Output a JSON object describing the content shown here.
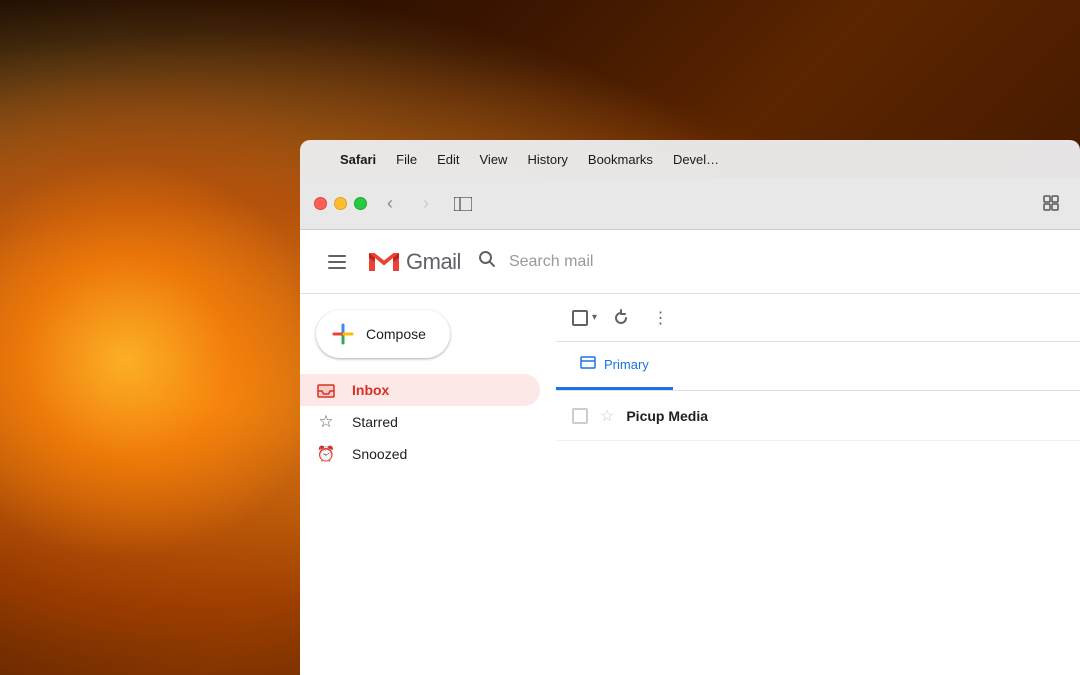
{
  "background": {
    "description": "Warm bokeh background with lamp/candle light"
  },
  "menubar": {
    "apple_symbol": "",
    "items": [
      {
        "label": "Safari",
        "bold": true
      },
      {
        "label": "File",
        "bold": false
      },
      {
        "label": "Edit",
        "bold": false
      },
      {
        "label": "View",
        "bold": false
      },
      {
        "label": "History",
        "bold": false
      },
      {
        "label": "Bookmarks",
        "bold": false
      },
      {
        "label": "Devel…",
        "bold": false
      }
    ]
  },
  "safari": {
    "back_icon": "‹",
    "forward_icon": "›",
    "sidebar_icon": "⊡",
    "grid_icon": "⠿"
  },
  "gmail": {
    "logo_letter": "M",
    "app_name": "Gmail",
    "search_placeholder": "Search mail",
    "compose_label": "Compose",
    "nav_items": [
      {
        "id": "inbox",
        "label": "Inbox",
        "icon": "inbox",
        "active": true
      },
      {
        "id": "starred",
        "label": "Starred",
        "icon": "star",
        "active": false
      },
      {
        "id": "snoozed",
        "label": "Snoozed",
        "icon": "alarm",
        "active": false
      }
    ],
    "tabs": [
      {
        "id": "primary",
        "label": "Primary",
        "active": true
      }
    ],
    "email_rows": [
      {
        "sender": "Picup Media",
        "preview": "",
        "date": ""
      }
    ]
  }
}
